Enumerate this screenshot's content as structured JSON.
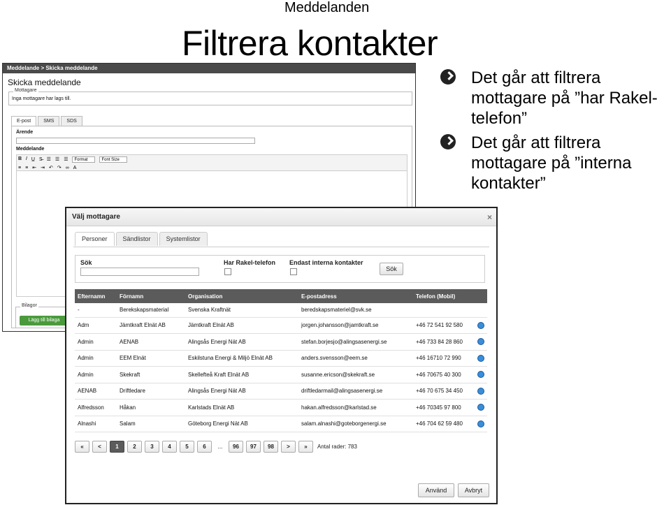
{
  "slide": {
    "subtitle": "Meddelanden",
    "title": "Filtrera kontakter",
    "bullets": [
      "Det går att filtrera mottagare på ”har Rakel-telefon”",
      "Det går att filtrera mottagare på ”interna kontakter”"
    ]
  },
  "back_window": {
    "breadcrumb": "Meddelande > Skicka meddelande",
    "heading": "Skicka meddelande",
    "recipients_legend": "Mottagare",
    "recipients_text": "Inga mottagare har lags till.",
    "tabs": [
      "E-post",
      "SMS",
      "SDS"
    ],
    "subject_label": "Ärende",
    "message_label": "Meddelande",
    "format_select": "Format",
    "font_size_select": "Font Size",
    "attachments_legend": "Bilagor",
    "add_attachment_button": "Lägg till bilaga"
  },
  "dialog": {
    "title": "Välj mottagare",
    "close": "×",
    "tabs": [
      "Personer",
      "Sändlistor",
      "Systemlistor"
    ],
    "search_label": "Sök",
    "filter_rakel_label": "Har Rakel-telefon",
    "filter_internal_label": "Endast interna kontakter",
    "search_button": "Sök",
    "columns": [
      "Efternamn",
      "Förnamn",
      "Organisation",
      "E-postadress",
      "Telefon (Mobil)"
    ],
    "rows": [
      [
        "-",
        "Berekskapsmaterial",
        "Svenska Kraftnät",
        "beredskapsmateriel@svk.se",
        ""
      ],
      [
        "Adm",
        "Jämtkraft Elnät AB",
        "Jämtkraft Elnät AB",
        "jorgen.johansson@jamtkraft.se",
        "+46 72 541 92 580"
      ],
      [
        "Admin",
        "AENAB",
        "Alingsås Energi Nät AB",
        "stefan.borjesjo@alingsasenergi.se",
        "+46 733 84 28 860"
      ],
      [
        "Admin",
        "EEM Elnät",
        "Eskilstuna Energi & Miljö Elnät AB",
        "anders.svensson@eem.se",
        "+46 16710 72 990"
      ],
      [
        "Admin",
        "Skekraft",
        "Skellefteå Kraft Elnät AB",
        "susanne.ericson@skekraft.se",
        "+46 70675 40 300"
      ],
      [
        "AENAB",
        "Driftledare",
        "Alingsås Energi Nät AB",
        "driftledarmail@alingsasenergi.se",
        "+46 70 675 34 450"
      ],
      [
        "Alfredsson",
        "Håkan",
        "Karlstads Elnät AB",
        "hakan.alfredsson@karlstad.se",
        "+46 70345 97 800"
      ],
      [
        "Alnashi",
        "Salam",
        "Göteborg Energi Nät AB",
        "salam.alnashi@goteborgenergi.se",
        "+46 704 62 59 480"
      ]
    ],
    "pager": {
      "first": "«",
      "prev": "<",
      "pages_start": [
        "1",
        "2",
        "3",
        "4",
        "5",
        "6"
      ],
      "ellipsis": "...",
      "pages_end": [
        "96",
        "97",
        "98"
      ],
      "next": ">",
      "last": "»",
      "active": "1",
      "count_text": "Antal rader: 783"
    },
    "apply_button": "Använd",
    "cancel_button": "Avbryt"
  },
  "colors": {
    "table_header": "#5b5b5b",
    "back_titlebar": "#4a4a4a",
    "green_button": "#4a9a3c",
    "phone_icon": "#3a8ed8"
  }
}
